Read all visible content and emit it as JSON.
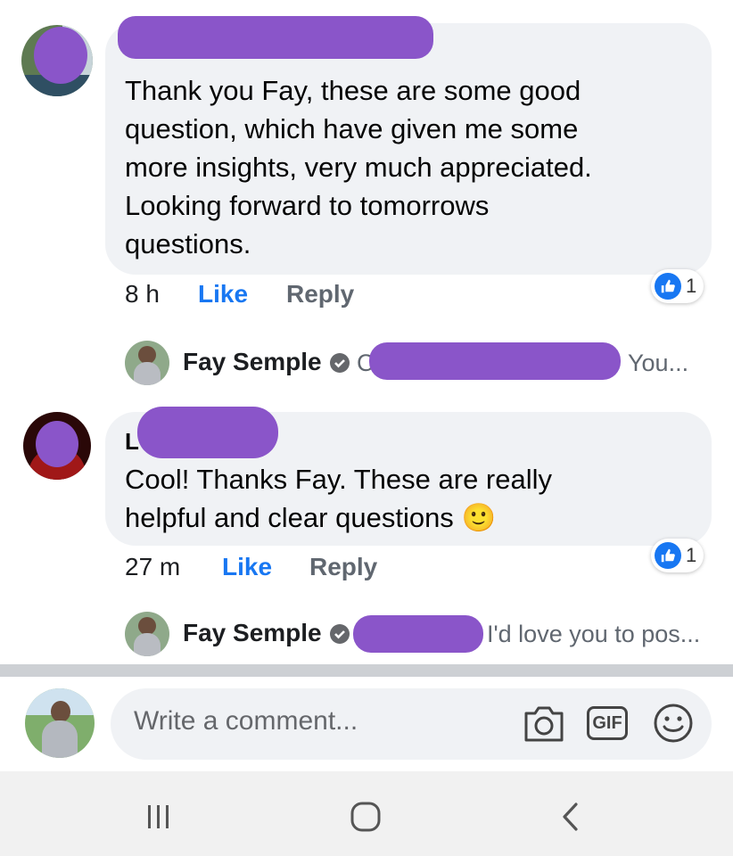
{
  "comments": [
    {
      "text": "Thank you Fay, these are some good question, which have given me some more insights, very much appreciated. Looking forward to tomorrows questions.",
      "lines": [
        "Thank you Fay, these are some good",
        "question, which have given me some",
        "more insights, very much appreciated.",
        "Looking forward to tomorrows",
        "questions."
      ],
      "time": "8 h",
      "like_label": "Like",
      "reply_label": "Reply",
      "reaction_count": "1",
      "reply": {
        "author": "Fay Semple",
        "preview_prefix": "C",
        "preview_suffix": "You..."
      }
    },
    {
      "author_initial": "L",
      "lines": [
        "Cool! Thanks Fay. These are really",
        "helpful and clear questions"
      ],
      "emoji": "🙂",
      "time": "27 m",
      "like_label": "Like",
      "reply_label": "Reply",
      "reaction_count": "1",
      "reply": {
        "author": "Fay Semple",
        "preview_suffix": "I'd love you to pos..."
      }
    }
  ],
  "composer": {
    "placeholder": "Write a comment...",
    "gif_label": "GIF"
  },
  "icons": {
    "camera": "camera-icon",
    "gif": "gif-icon",
    "emoji": "emoji-icon",
    "like": "thumbs-up-icon",
    "verified": "verified-badge-icon",
    "nav_recents": "recent-apps-icon",
    "nav_home": "home-icon",
    "nav_back": "back-icon"
  },
  "colors": {
    "like_blue": "#1877f2",
    "redaction": "#8a55c9",
    "bubble": "#f0f2f5"
  }
}
